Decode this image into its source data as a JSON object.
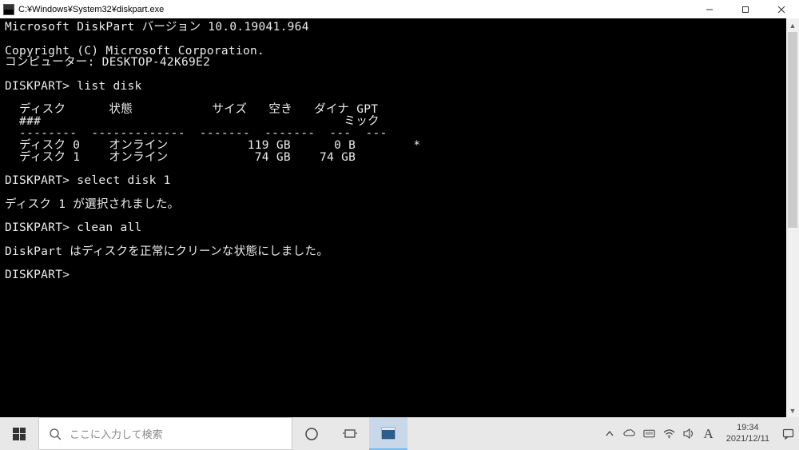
{
  "titlebar": {
    "title": "C:¥Windows¥System32¥diskpart.exe"
  },
  "terminal": {
    "header_line": "Microsoft DiskPart バージョン 10.0.19041.964",
    "copyright": "Copyright (C) Microsoft Corporation.",
    "computer_line": "コンピューター: DESKTOP-42K69E2",
    "prompt1": "DISKPART> list disk",
    "table": {
      "header1": "  ディスク      状態           サイズ   空き   ダイナ GPT",
      "header2": "  ###                                          ミック",
      "divider": "  --------  -------------  -------  -------  ---  ---",
      "row1": "  ディスク 0    オンライン           119 GB      0 B        *",
      "row2": "  ディスク 1    オンライン            74 GB    74 GB"
    },
    "prompt2": "DISKPART> select disk 1",
    "msg_select": "ディスク 1 が選択されました。",
    "prompt3": "DISKPART> clean all",
    "msg_clean": "DiskPart はディスクを正常にクリーンな状態にしました。",
    "prompt4": "DISKPART> "
  },
  "taskbar": {
    "search_placeholder": "ここに入力して検索",
    "time": "19:34",
    "date": "2021/12/11",
    "ime": "A"
  }
}
